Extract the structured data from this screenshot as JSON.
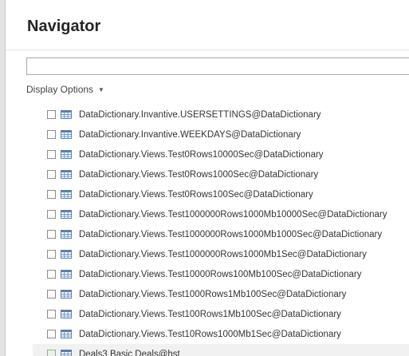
{
  "dialog": {
    "title": "Navigator",
    "search": {
      "value": "",
      "placeholder": ""
    },
    "display_options_label": "Display Options"
  },
  "tree": {
    "items": [
      {
        "label": "DataDictionary.Invantive.USERSETTINGS@DataDictionary",
        "icon": "table-icon"
      },
      {
        "label": "DataDictionary.Invantive.WEEKDAYS@DataDictionary",
        "icon": "table-icon"
      },
      {
        "label": "DataDictionary.Views.Test0Rows10000Sec@DataDictionary",
        "icon": "table-icon"
      },
      {
        "label": "DataDictionary.Views.Test0Rows1000Sec@DataDictionary",
        "icon": "table-icon"
      },
      {
        "label": "DataDictionary.Views.Test0Rows100Sec@DataDictionary",
        "icon": "table-icon"
      },
      {
        "label": "DataDictionary.Views.Test1000000Rows1000Mb10000Sec@DataDictionary",
        "icon": "table-icon"
      },
      {
        "label": "DataDictionary.Views.Test1000000Rows1000Mb1000Sec@DataDictionary",
        "icon": "table-icon"
      },
      {
        "label": "DataDictionary.Views.Test1000000Rows1000Mb1Sec@DataDictionary",
        "icon": "table-icon"
      },
      {
        "label": "DataDictionary.Views.Test10000Rows100Mb100Sec@DataDictionary",
        "icon": "table-icon"
      },
      {
        "label": "DataDictionary.Views.Test1000Rows1Mb100Sec@DataDictionary",
        "icon": "table-icon"
      },
      {
        "label": "DataDictionary.Views.Test100Rows1Mb100Sec@DataDictionary",
        "icon": "table-icon"
      },
      {
        "label": "DataDictionary.Views.Test10Rows1000Mb1Sec@DataDictionary",
        "icon": "table-icon"
      },
      {
        "label": "Deals3 Basic Deals@hst",
        "icon": "table-icon",
        "selected": true
      }
    ]
  },
  "colors": {
    "table_icon": "#5a7eb0",
    "selected_row": "#f1f1f1",
    "partial_check": "#e6f3e6"
  }
}
